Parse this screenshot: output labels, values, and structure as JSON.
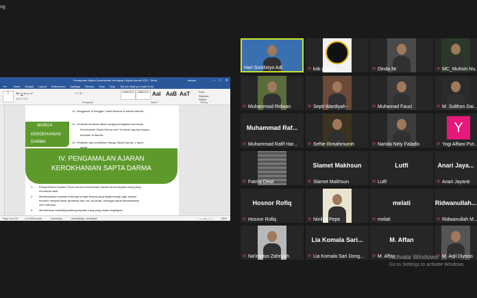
{
  "meeting": {
    "top_label": "ng"
  },
  "shared_window": {
    "title": "Pemaparan Materi Sarahsehan Kemajuan Sapta Darma 2021 - Word",
    "user": "ahmad",
    "tabs": [
      "File",
      "Insert",
      "Design",
      "Layout",
      "References",
      "Mailings",
      "Review",
      "View",
      "Help",
      "Tell me what you want to do"
    ],
    "ribbon": {
      "style_normal": "AaBbCcDc",
      "style_nospacing": "AaBbCcDc",
      "style_heading1": "AaI",
      "style_heading2": "AaB",
      "style_aat": "AaT",
      "find": "Find",
      "replace": "Replace",
      "select": "Select",
      "groups": [
        "Paragraph",
        "Styles",
        "Editing"
      ]
    },
    "document": {
      "item10": "10.   Sanggaran di Sanggar Candi Busana di daerah-daerah.",
      "item11_a": "11.   Ceramah-ceramah dalam rangka peringatan hari besar",
      "item11_b": "Kerokhanian Sapta Darma oleh Tuntunan Agung maupun",
      "item11_c": "tuntunan di daerah.",
      "item12_a": "12.   Pelatihan dan pendidikan Warga Sapta Darma, 1 tahun",
      "item12_b": "sekali.",
      "callout_line1": "WARGA",
      "callout_line2": "KEROKHANIAN",
      "callout_line3": "DARMA",
      "banner_line1": "IV. PENGAMALAN AJARAN",
      "banner_line2": "KEROKHANIAN SAPTA DARMA",
      "p1_a": "Penyembuhan di jalan Tuhan secara Kerokhanian Sapta Darma kepada orang yang",
      "p1_b": "menderita sakit.",
      "p2_a": "Melaksanakan ruwatan terhadap tempat-tempat yang angker/wingit agar tempat",
      "p2_b": "tersebut menjadi tawar (terbebas dari roh-roh jahat), sehingga dapat dimanfaatkan",
      "p2_c": "oleh manusia.",
      "p3": "Memberikan nasihat/pepadang kepada orang yang dalam kegelapan."
    },
    "status": {
      "page": "Page 14 of 16",
      "words": "4 of 3005 words",
      "lang": "Indonesian",
      "access": "Accessibility: Investigate",
      "zoom": "100%"
    }
  },
  "participants": [
    {
      "name": "Hari Sosilistyo Adi",
      "type": "video",
      "active": true,
      "muted": false
    },
    {
      "name": "ksk panitia",
      "type": "logo",
      "muted": true
    },
    {
      "name": "Dinda Nr",
      "type": "video",
      "muted": true
    },
    {
      "name": "MC_Muhsin Nu...",
      "type": "video",
      "muted": true
    },
    {
      "name": "Muhammad Ridwan",
      "type": "video",
      "muted": true
    },
    {
      "name": "Septi Wardiyah -",
      "type": "image",
      "muted": true
    },
    {
      "name": "Muhamad Fauzi",
      "type": "video",
      "muted": true
    },
    {
      "name": "M. Sulthon Dai...",
      "type": "video",
      "muted": true
    },
    {
      "name": "Muhammad Rafif Har...",
      "type": "name",
      "big": "Muhammad Raf...",
      "muted": true
    },
    {
      "name": "Seftie Rimahmuroh",
      "type": "video",
      "muted": true
    },
    {
      "name": "Narida Nely Faladis",
      "type": "video",
      "muted": true
    },
    {
      "name": "Yogi Alfiani Put...",
      "type": "avatar",
      "big": "Y",
      "muted": true
    },
    {
      "name": "Fatma Dewi",
      "type": "blur",
      "muted": true
    },
    {
      "name": "Slamet Makhsun",
      "type": "name",
      "big": "Slamet Makhsun",
      "muted": true
    },
    {
      "name": "Lutfi",
      "type": "name",
      "big": "Lutfi",
      "muted": true
    },
    {
      "name": "Anari Jayanti",
      "type": "name",
      "big": "Anari Jaya...",
      "muted": true
    },
    {
      "name": "Hosnor Rofiq",
      "type": "name",
      "big": "Hosnor Rofiq",
      "muted": true
    },
    {
      "name": "Ninilya Pepe",
      "type": "image",
      "muted": true
    },
    {
      "name": "melati",
      "type": "name",
      "big": "melati",
      "muted": true
    },
    {
      "name": "Ridwanullah M...",
      "type": "name",
      "big": "Ridwanullah...",
      "muted": true
    },
    {
      "name": "Na'imatus Zahriyah",
      "type": "image",
      "muted": true
    },
    {
      "name": "Lia Komala Sari Dong...",
      "type": "name",
      "big": "Lia Komala Sari...",
      "muted": true
    },
    {
      "name": "M. Affan",
      "type": "name",
      "big": "M. Affan",
      "muted": true
    },
    {
      "name": "M. Aqil Diyono",
      "type": "image",
      "muted": true
    }
  ],
  "watermark": {
    "line1": "Activate Windows",
    "line2": "Go to Settings to activate Windows."
  },
  "colors": {
    "accent_active": "#c8e62a",
    "muted_mic": "#ff4a4a",
    "word_blue": "#2b579a",
    "green": "#5e9a2b",
    "avatar_pink": "#e6197a"
  }
}
